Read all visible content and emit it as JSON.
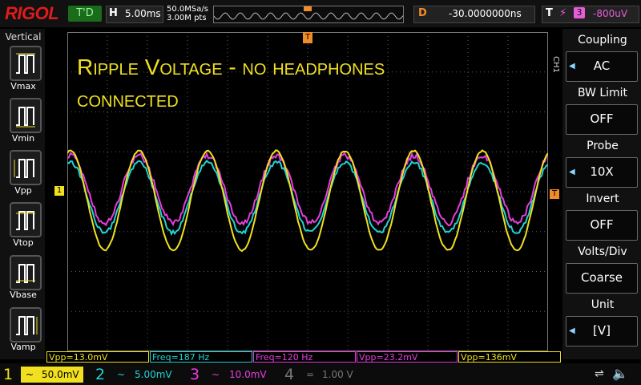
{
  "top": {
    "logo": "RIGOL",
    "run_state": "T'D",
    "h_label": "H",
    "h_value": "5.00ms",
    "sample_rate": "50.0MSa/s",
    "mem_depth": "3.00M pts",
    "delay_label": "D",
    "delay_value": "-30.0000000ns",
    "trigger_label": "T",
    "trigger_source": "3",
    "trigger_value": "-800uV"
  },
  "left": {
    "title": "Vertical",
    "items": [
      "Vmax",
      "Vmin",
      "Vpp",
      "Vtop",
      "Vbase",
      "Vamp"
    ]
  },
  "annotation": {
    "line1": "Ripple Voltage - no headphones",
    "line2": "connected"
  },
  "right": {
    "channel_tag": "CH1",
    "menus": [
      {
        "title": "Coupling",
        "value": "AC"
      },
      {
        "title": "BW Limit",
        "value": "OFF"
      },
      {
        "title": "Probe",
        "value": "10X"
      },
      {
        "title": "Invert",
        "value": "OFF"
      },
      {
        "title": "Volts/Div",
        "value": "Coarse"
      },
      {
        "title": "Unit",
        "value": "[V]"
      }
    ]
  },
  "measurements": [
    {
      "text": "Vpp=13.0mV",
      "color": "#f0e020"
    },
    {
      "text": "Freq=187 Hz",
      "color": "#22d3d3"
    },
    {
      "text": "Freq=120 Hz",
      "color": "#e83de0"
    },
    {
      "text": "Vpp=23.2mV",
      "color": "#e83de0"
    },
    {
      "text": "Vpp=136mV",
      "color": "#f0e020"
    }
  ],
  "channels": [
    {
      "num": "1",
      "coupling": "~",
      "scale": "50.0mV",
      "color": "#f0e020"
    },
    {
      "num": "2",
      "coupling": "~",
      "scale": "5.00mV",
      "color": "#22d3d3"
    },
    {
      "num": "3",
      "coupling": "~",
      "scale": "10.0mV",
      "color": "#e83de0"
    },
    {
      "num": "4",
      "coupling": "=",
      "scale": "1.00 V",
      "color": "#777777"
    }
  ],
  "markers": {
    "ch1_level": "1",
    "trigger_level": "T",
    "trigger_pos": "T"
  },
  "waveforms": {
    "ch1_color": "#f0e020",
    "ch2_color": "#22d3d3",
    "ch3_color": "#e83de0",
    "cycles": 7
  },
  "colors": {
    "grid": "#5a5a5a",
    "trigger": "#f28c28"
  }
}
